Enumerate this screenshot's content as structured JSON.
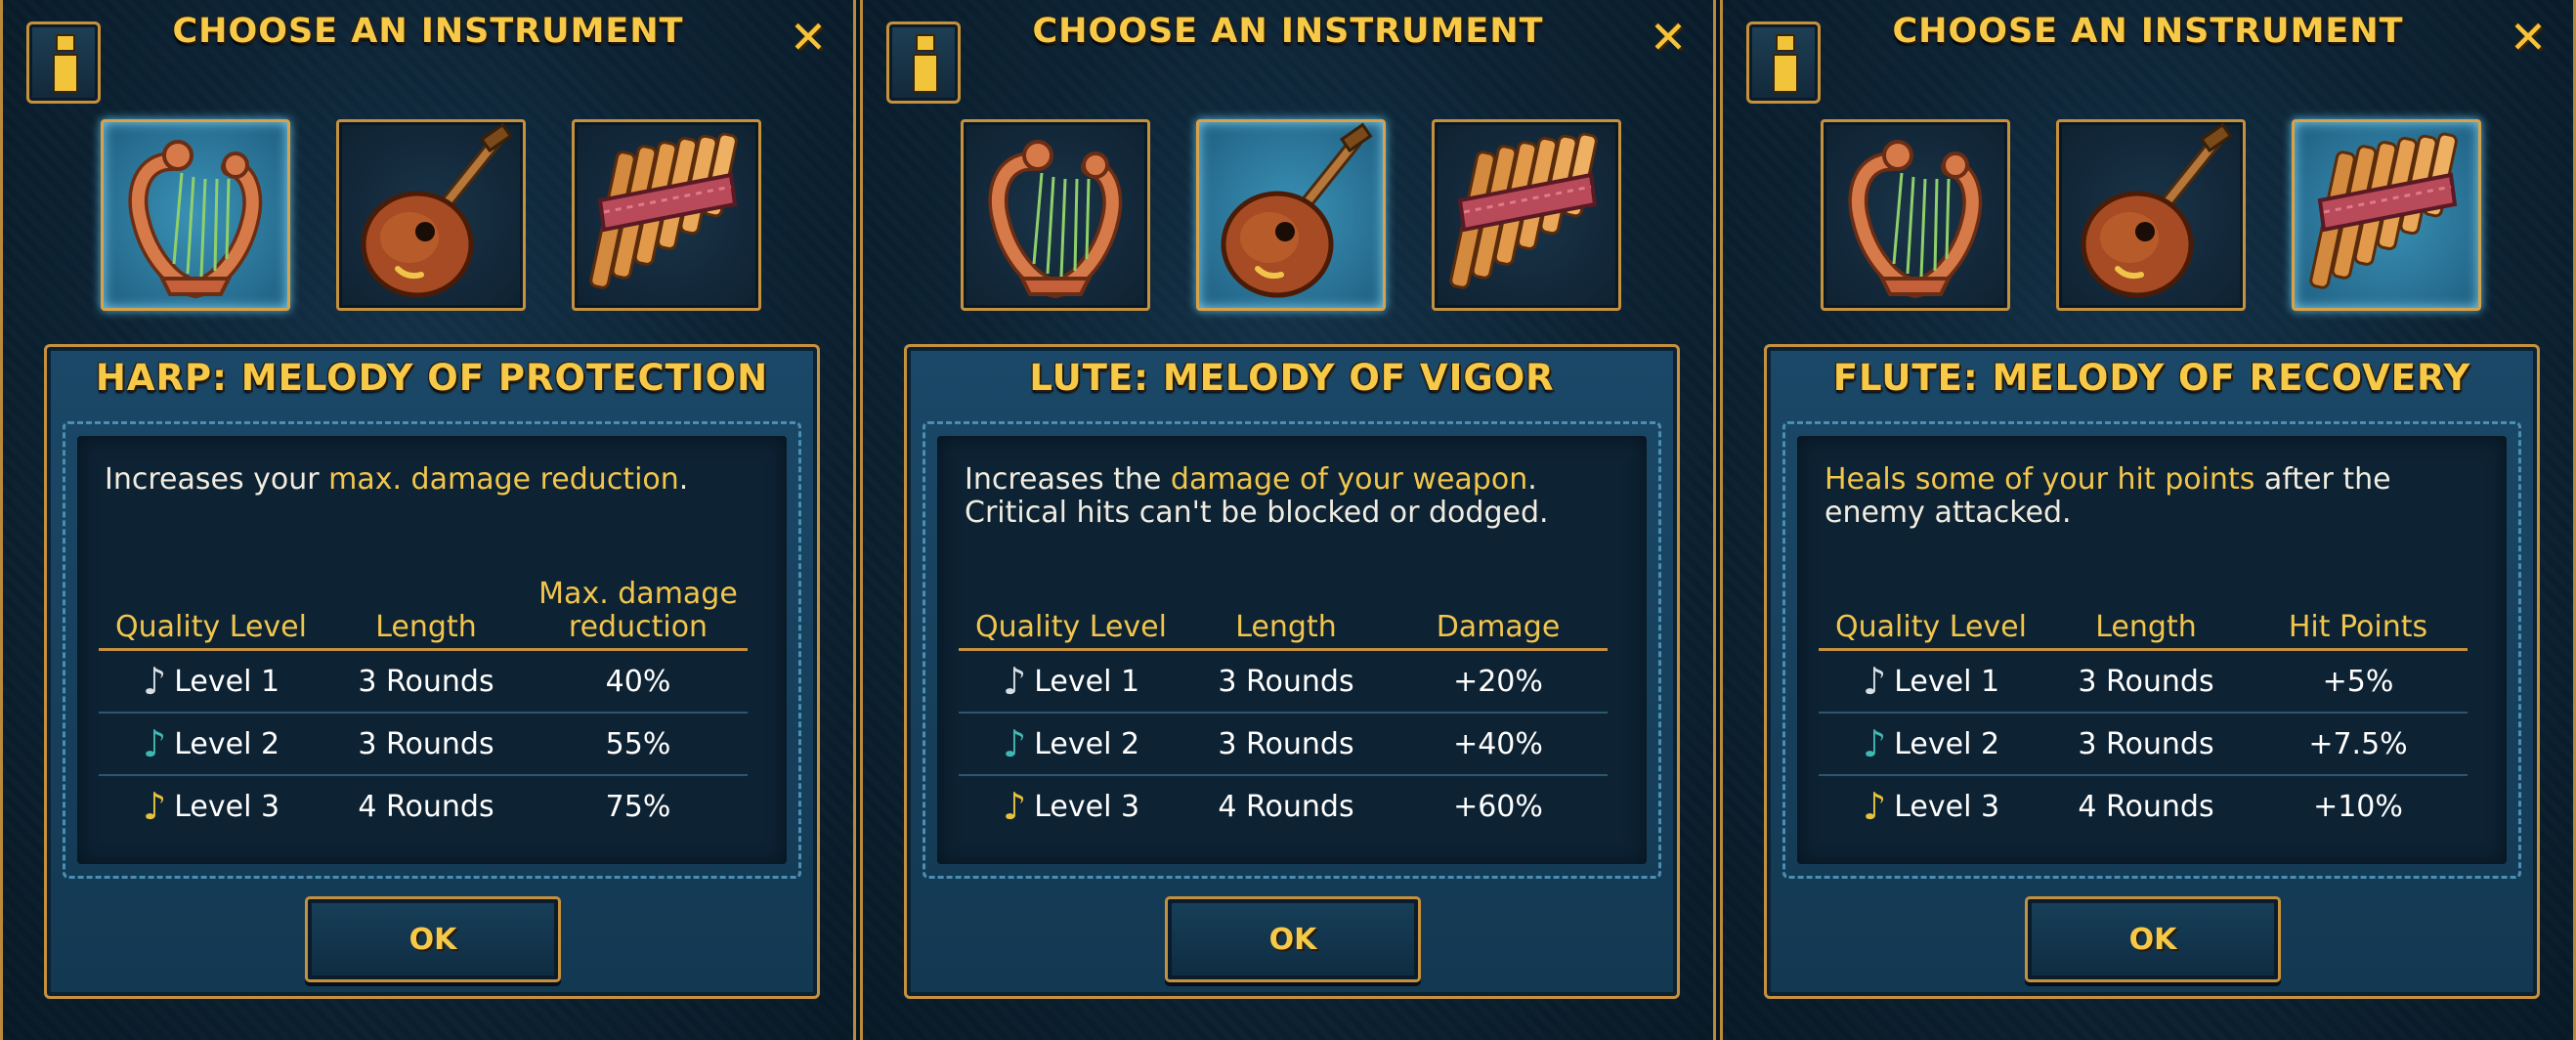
{
  "colors": {
    "gold": "#f7c948",
    "highlight_text": "#f2c64d",
    "frame": "#c6913d",
    "selected_slot": "#3a92b6",
    "panel_bg": "#0c2233",
    "note_level_1": "#d6dde3",
    "note_level_2": "#3fb8b2",
    "note_level_3": "#e8c23a"
  },
  "icons": {
    "info": "info-icon",
    "close": "close-icon",
    "harp": "harp-icon",
    "lute": "lute-icon",
    "pan_flute": "pan-flute-icon",
    "note": "music-note-icon"
  },
  "close_glyph": "✕",
  "panels": [
    {
      "header_title": "CHOOSE AN INSTRUMENT",
      "selected_instrument": "harp",
      "melody_title": "HARP: MELODY OF PROTECTION",
      "desc": {
        "pre": "Increases your ",
        "highlight": "max. damage reduction",
        "post": "."
      },
      "table": {
        "headers": [
          "Quality Level",
          "Length",
          "Max. damage reduction"
        ],
        "rows": [
          {
            "level": "Level 1",
            "length": "3 Rounds",
            "value": "40%"
          },
          {
            "level": "Level 2",
            "length": "3 Rounds",
            "value": "55%"
          },
          {
            "level": "Level 3",
            "length": "4 Rounds",
            "value": "75%"
          }
        ]
      },
      "ok_label": "OK"
    },
    {
      "header_title": "CHOOSE AN INSTRUMENT",
      "selected_instrument": "lute",
      "melody_title": "LUTE: MELODY OF VIGOR",
      "desc": {
        "pre": "Increases the ",
        "highlight": "damage of your weapon",
        "post": ". Critical hits can't be blocked or dodged."
      },
      "table": {
        "headers": [
          "Quality Level",
          "Length",
          "Damage"
        ],
        "rows": [
          {
            "level": "Level 1",
            "length": "3 Rounds",
            "value": "+20%"
          },
          {
            "level": "Level 2",
            "length": "3 Rounds",
            "value": "+40%"
          },
          {
            "level": "Level 3",
            "length": "4 Rounds",
            "value": "+60%"
          }
        ]
      },
      "ok_label": "OK"
    },
    {
      "header_title": "CHOOSE AN INSTRUMENT",
      "selected_instrument": "flute",
      "melody_title": "FLUTE: MELODY OF RECOVERY",
      "desc": {
        "pre": "",
        "highlight": "Heals some of your hit points",
        "post": " after the enemy attacked."
      },
      "table": {
        "headers": [
          "Quality Level",
          "Length",
          "Hit Points"
        ],
        "rows": [
          {
            "level": "Level 1",
            "length": "3 Rounds",
            "value": "+5%"
          },
          {
            "level": "Level 2",
            "length": "3 Rounds",
            "value": "+7.5%"
          },
          {
            "level": "Level 3",
            "length": "4 Rounds",
            "value": "+10%"
          }
        ]
      },
      "ok_label": "OK"
    }
  ]
}
